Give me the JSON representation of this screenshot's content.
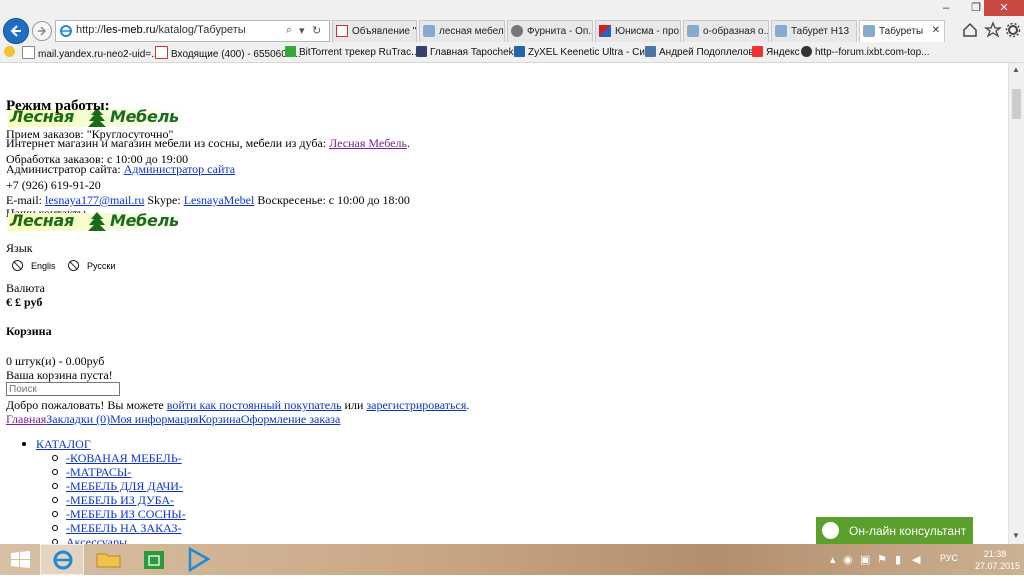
{
  "browser": {
    "address": {
      "scheme": "http://",
      "domain": "les-meb.ru",
      "path": "/katalog/Табуреты"
    },
    "tabs": [
      {
        "label": "Объявление \"...",
        "icon": "gmail-icon"
      },
      {
        "label": "лесная мебел...",
        "icon": "ie-page-icon"
      },
      {
        "label": "Фурнита - Оп...",
        "icon": "furnita-icon"
      },
      {
        "label": "Юнисма - про...",
        "icon": "unisma-icon"
      },
      {
        "label": "о-образная о...",
        "icon": "ie-page-icon"
      },
      {
        "label": "Табурет Н13",
        "icon": "ie-page-icon"
      },
      {
        "label": "Табуреты",
        "icon": "ie-page-icon",
        "active": true
      }
    ],
    "favorites": [
      {
        "label": "mail.yandex.ru-neo2-uid=...",
        "icon": "mail-icon"
      },
      {
        "label": "Входящие (400) - 6550607...",
        "icon": "gmail-icon"
      },
      {
        "label": "BitTorrent трекер RuTrac...",
        "icon": "torrent-icon"
      },
      {
        "label": "Главная Tapochek",
        "icon": "tapochek-icon"
      },
      {
        "label": "ZyXEL Keenetic Ultra - Си...",
        "icon": "zyxel-icon"
      },
      {
        "label": "Андрей Подоплелов",
        "icon": "vk-icon"
      },
      {
        "label": "Яндекс",
        "icon": "yandex-icon"
      },
      {
        "label": "http--forum.ixbt.com-top...",
        "icon": "ixbt-icon"
      }
    ]
  },
  "page": {
    "logo_text_left": "Лесная",
    "logo_text_right": "Мебель",
    "hours_heading": "Режим работы:",
    "orders_line": "Прием заказов: \"Круглосуточно\"",
    "intro_text": "Интернет магазин и магазин мебели из сосны, мебели из дуба:",
    "intro_link": "Лесная Мебель",
    "processing_line": "Обработка заказов: с 10:00 до 19:00",
    "admin_label": "Администратор сайта:",
    "admin_link": "Администратор сайта",
    "phone": "+7 (926) 619-91-20",
    "email_label": "E-mail:",
    "email_link": "lesnaya177@mail.ru",
    "skype_label": "Skype:",
    "skype_link": "LesnayaMebel",
    "sunday_line": "Воскресенье: с 10:00 до 18:00",
    "contacts_label": "Наши контакты",
    "language_label": "Язык",
    "lang_english": "Englis",
    "lang_russian": "Русски",
    "currency_label": "Валюта",
    "currency_symbols": "€ £",
    "currency_rub": "руб",
    "cart_heading": "Корзина",
    "cart_count": "0 штук(и) - 0.00руб",
    "cart_empty": "Ваша корзина пуста!",
    "search_placeholder": "Поиск",
    "welcome_text": "Добро пожаловать! Вы можете",
    "login_link": "войти как постоянный покупатель",
    "or_text": "или",
    "register_link": "зарегистрироваться",
    "nav": [
      "Главная",
      "Закладки (0)",
      "Моя информация",
      "Корзина",
      "Оформление заказа"
    ],
    "catalog_label": "КАТАЛОГ",
    "catalog_items": [
      "-КОВАНАЯ МЕБЕЛЬ-",
      "-МАТРАСЫ-",
      "-МЕБЕЛЬ ДЛЯ ДАЧИ-",
      "-МЕБЕЛЬ ИЗ ДУБА-",
      "-МЕБЕЛЬ ИЗ СОСНЫ-",
      "-МЕБЕЛЬ НА ЗАКАЗ-",
      "Аксессуары"
    ],
    "consultant_label": "Он-лайн консультант"
  },
  "taskbar": {
    "lang": "РУС",
    "time": "21:38",
    "date": "27.07.2015"
  },
  "colors": {
    "link": "#0b33c9",
    "visited": "#7a1f98",
    "logo_green": "#1a6a1a",
    "consult_green": "#5c9f2c"
  }
}
